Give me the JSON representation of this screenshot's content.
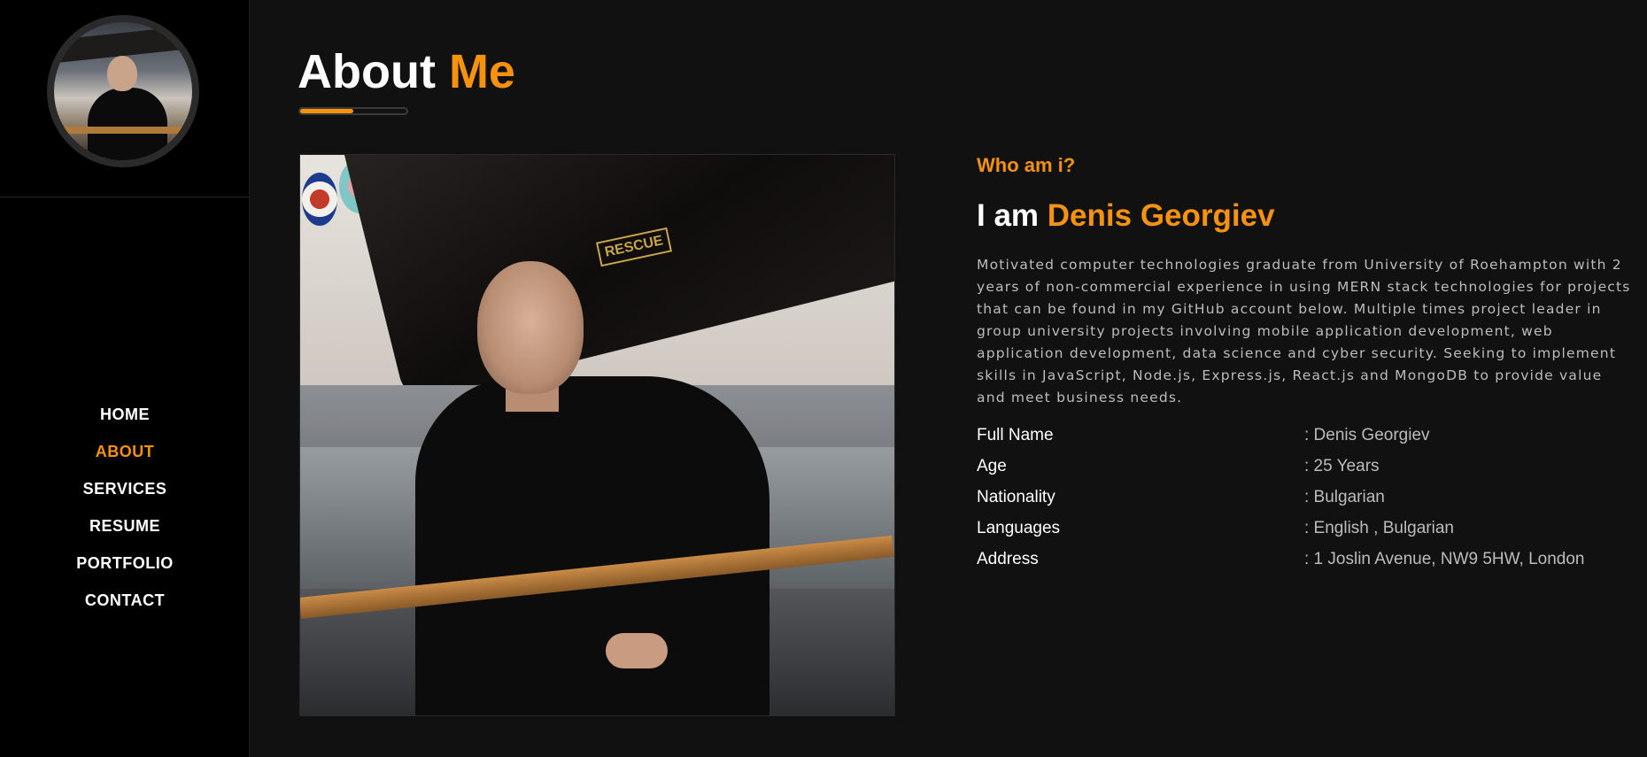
{
  "sidebar": {
    "avatar_icon": "profile-photo",
    "nav": [
      {
        "label": "HOME",
        "active": false
      },
      {
        "label": "ABOUT",
        "active": true
      },
      {
        "label": "SERVICES",
        "active": false
      },
      {
        "label": "RESUME",
        "active": false
      },
      {
        "label": "PORTFOLIO",
        "active": false
      },
      {
        "label": "CONTACT",
        "active": false
      }
    ]
  },
  "header": {
    "title_main": "About",
    "title_accent": "Me",
    "accent_color": "#f7920f",
    "title_bar_fill_percent": 50
  },
  "photo": {
    "sign_text": "RESCUE"
  },
  "about": {
    "subtitle": "Who am i?",
    "intro_prefix": "I am",
    "name": "Denis Georgiev",
    "bio": "Motivated computer technologies graduate from University of Roehampton with 2 years of non-commercial experience in using MERN stack technologies for projects that can be found in my GitHub account below. Multiple times project leader in group university projects involving mobile application development, web application development, data science and cyber security. Seeking to implement skills in JavaScript, Node.js, Express.js, React.js and MongoDB to provide value and meet business needs.",
    "details": [
      {
        "label": "Full Name",
        "value": ": Denis Georgiev"
      },
      {
        "label": "Age",
        "value": ": 25 Years"
      },
      {
        "label": "Nationality",
        "value": ": Bulgarian"
      },
      {
        "label": "Languages",
        "value": ": English , Bulgarian"
      },
      {
        "label": "Address",
        "value": ": 1 Joslin Avenue, NW9 5HW, London"
      }
    ]
  }
}
